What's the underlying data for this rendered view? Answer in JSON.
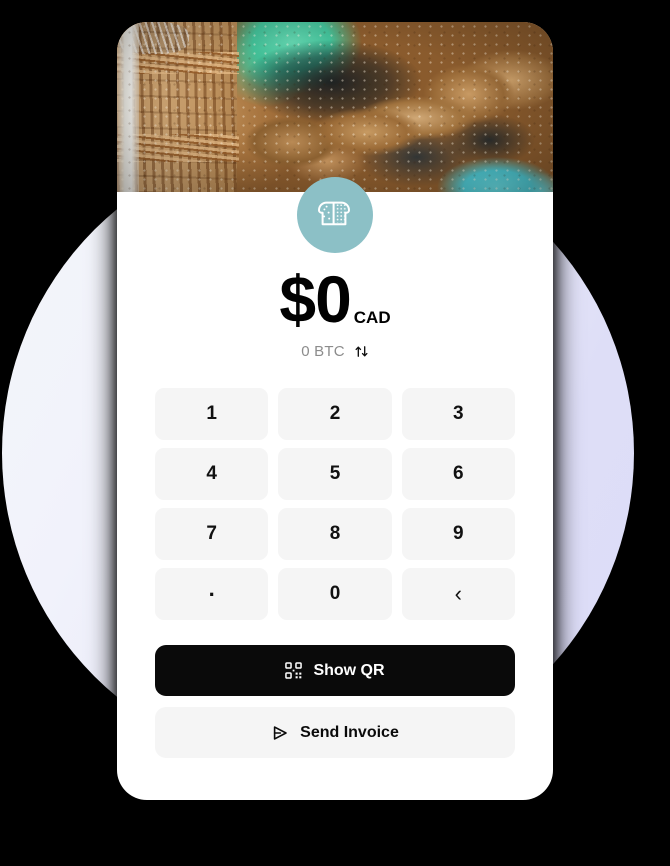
{
  "app": {
    "merchant_avatar_icon": "bread-loaf-icon",
    "avatar_bg_color": "#8cc0c6",
    "banner_image_alt": "bakery-bread-photo"
  },
  "amount": {
    "primary": "$0",
    "currency_code": "CAD",
    "secondary": "0 BTC",
    "swap_icon": "swap-vertical-arrows-icon"
  },
  "keypad": {
    "keys": [
      {
        "label": "1",
        "name": "key-1"
      },
      {
        "label": "2",
        "name": "key-2"
      },
      {
        "label": "3",
        "name": "key-3"
      },
      {
        "label": "4",
        "name": "key-4"
      },
      {
        "label": "5",
        "name": "key-5"
      },
      {
        "label": "6",
        "name": "key-6"
      },
      {
        "label": "7",
        "name": "key-7"
      },
      {
        "label": "8",
        "name": "key-8"
      },
      {
        "label": "9",
        "name": "key-9"
      },
      {
        "label": ".",
        "name": "key-decimal"
      },
      {
        "label": "0",
        "name": "key-0"
      },
      {
        "label": "‹",
        "name": "key-backspace"
      }
    ]
  },
  "actions": {
    "show_qr_label": "Show QR",
    "show_qr_icon": "qr-code-icon",
    "show_qr_bg": "#0a0a0a",
    "send_invoice_label": "Send Invoice",
    "send_invoice_icon": "send-arrow-icon",
    "send_invoice_bg": "#f5f5f5"
  }
}
